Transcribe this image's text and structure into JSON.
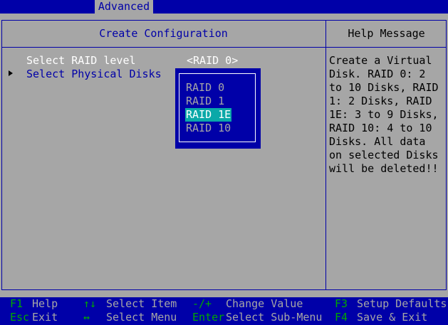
{
  "topbar": {
    "active_tab": "Advanced"
  },
  "left_panel": {
    "title": "Create Configuration"
  },
  "right_panel": {
    "title": "Help Message"
  },
  "settings": {
    "raid_level_label": "Select RAID level",
    "raid_level_value": "<RAID 0>",
    "physical_disks_label": "Select Physical Disks"
  },
  "popup": {
    "options": [
      "RAID 0",
      "RAID 1",
      "RAID 1E",
      "RAID 10"
    ],
    "selected_index": 2
  },
  "help_text": "Create a Virtual Disk. RAID 0: 2 to 10 Disks, RAID 1: 2 Disks, RAID 1E: 3 to 9 Disks, RAID 10: 4 to 10 Disks. All data on selected Disks will be deleted!!",
  "footer": {
    "k1": "F1",
    "d1": "Help",
    "k2": "Esc",
    "d2": "Exit",
    "k3": "↑↓",
    "d3": "Select Item",
    "k4": "↔",
    "d4": "Select Menu",
    "k5": "-/+",
    "d5": "Change Value",
    "k6": "Enter",
    "d6": "Select Sub-Menu",
    "k7": "F3",
    "d7": "Setup Defaults",
    "k8": "F4",
    "d8": "Save & Exit"
  },
  "colors": {
    "background": "#a6a6a6",
    "accent": "#0000a8",
    "selection": "#0aa8a8",
    "key": "#00a800"
  }
}
